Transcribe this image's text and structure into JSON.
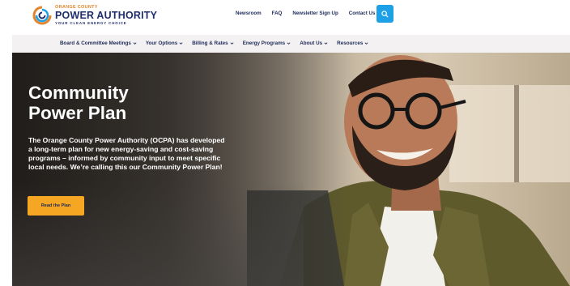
{
  "header": {
    "logo": {
      "line1": "ORANGE COUNTY",
      "line2": "POWER AUTHORITY",
      "tagline": "YOUR CLEAN ENERGY CHOICE"
    },
    "top_links": [
      "Newsroom",
      "FAQ",
      "Newsletter Sign Up",
      "Contact Us"
    ],
    "search_icon": "search-icon",
    "accent": "#1ea0e6"
  },
  "nav": {
    "items": [
      "Board & Committee Meetings",
      "Your Options",
      "Billing & Rates",
      "Energy Programs",
      "About Us",
      "Resources"
    ]
  },
  "hero": {
    "title_line1": "Community",
    "title_line2": "Power Plan",
    "text": "The Orange County Power Authority (OCPA) has developed a long-term plan for new energy-saving and cost-saving programs – informed by community input to meet specific local needs. We’re calling this our Community Power Plan!",
    "button": "Read the Plan",
    "button_color": "#f5a623"
  }
}
